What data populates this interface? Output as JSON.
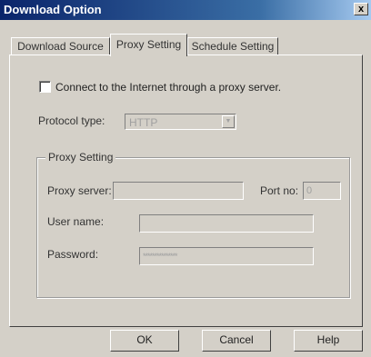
{
  "window": {
    "title": "Download Option",
    "close_label": "x"
  },
  "tabs": [
    {
      "label": "Download Source",
      "active": false
    },
    {
      "label": "Proxy Setting",
      "active": true
    },
    {
      "label": "Schedule Setting",
      "active": false
    }
  ],
  "proxy": {
    "checkbox_label": "Connect to the Internet through a proxy server.",
    "checkbox_checked": false,
    "protocol_label": "Protocol type:",
    "protocol_value": "HTTP",
    "group_title": "Proxy Setting",
    "server_label": "Proxy server:",
    "server_value": "",
    "port_label": "Port no:",
    "port_value": "0",
    "username_label": "User name:",
    "username_value": "",
    "password_label": "Password:",
    "password_value": "***************"
  },
  "buttons": {
    "ok": "OK",
    "cancel": "Cancel",
    "help": "Help"
  }
}
